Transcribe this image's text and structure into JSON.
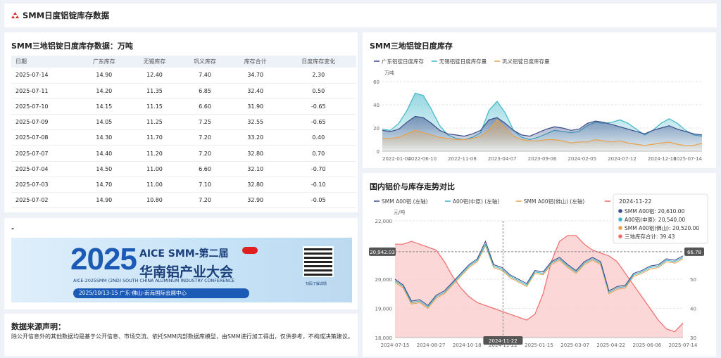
{
  "header": {
    "title": "SMM日度铝锭库存数据"
  },
  "table": {
    "title": "SMM三地铝锭日度库存数据：万吨",
    "columns": [
      "日期",
      "广东库存",
      "无锡库存",
      "巩义库存",
      "库存合计",
      "日度库存变化"
    ],
    "rows": [
      [
        "2025-07-14",
        "14.90",
        "12.40",
        "7.40",
        "34.70",
        "2.30"
      ],
      [
        "2025-07-11",
        "14.20",
        "11.35",
        "6.85",
        "32.40",
        "0.50"
      ],
      [
        "2025-07-10",
        "14.15",
        "11.15",
        "6.60",
        "31.90",
        "-0.65"
      ],
      [
        "2025-07-09",
        "14.05",
        "11.25",
        "7.25",
        "32.55",
        "-0.65"
      ],
      [
        "2025-07-08",
        "14.30",
        "11.70",
        "7.20",
        "33.20",
        "0.40"
      ],
      [
        "2025-07-07",
        "14.40",
        "11.20",
        "7.20",
        "32.80",
        "0.70"
      ],
      [
        "2025-07-04",
        "14.50",
        "11.00",
        "6.60",
        "32.10",
        "-0.70"
      ],
      [
        "2025-07-03",
        "14.70",
        "11.00",
        "7.10",
        "32.80",
        "-0.10"
      ],
      [
        "2025-07-02",
        "14.90",
        "10.80",
        "7.20",
        "32.90",
        "-0.05"
      ]
    ]
  },
  "ad": {
    "section": "-",
    "year": "2025",
    "line1": "AICE SMM-第二届",
    "line2": "华南铝产业大会",
    "line3": "AICE-2025SMM (2ND) SOUTH CHINA ALUMINUM INDUSTRY CONFERENCE",
    "line4": "2025/10/13-15  广东·佛山-南海国际会展中心",
    "qr_label": "扫码了解详情"
  },
  "source": {
    "title": "数据来源声明：",
    "body": "除公开信息外的其他数据均是基于公开信息、市场交流、依托SMM内部数据库模型，由SMM进行加工得出，仅供参考，不构成决策建议。"
  },
  "chart_data": [
    {
      "type": "area",
      "title": "SMM三地铝锭日度库存",
      "ylabel": "万吨",
      "ylim": [
        0,
        60
      ],
      "yticks": [
        "60",
        "40",
        "20",
        "0"
      ],
      "xticks": [
        "2022-01-04",
        "2022-06-10",
        "2022-11-08",
        "2023-04-07",
        "2023-09-06",
        "2024-02-05",
        "2024-07-12",
        "2024-12-16",
        "2025-07-14"
      ],
      "legend_position": "top-left",
      "series": [
        {
          "name": "广东铝锭日度库存",
          "color": "#3b4c8a",
          "values": [
            18,
            17,
            19,
            25,
            30,
            29,
            24,
            18,
            15,
            14,
            13,
            15,
            18,
            27,
            29,
            24,
            18,
            14,
            13,
            16,
            19,
            21,
            20,
            18,
            19,
            24,
            26,
            25,
            23,
            21,
            19,
            17,
            15,
            18,
            20,
            22,
            19,
            17,
            15,
            14
          ]
        },
        {
          "name": "无锡铝锭日度库存量",
          "color": "#3fb6c8",
          "values": [
            19,
            18,
            24,
            35,
            50,
            48,
            36,
            22,
            14,
            11,
            10,
            12,
            16,
            35,
            43,
            33,
            18,
            12,
            10,
            12,
            15,
            18,
            17,
            16,
            17,
            22,
            25,
            24,
            25,
            27,
            24,
            19,
            14,
            18,
            24,
            28,
            24,
            18,
            14,
            13
          ]
        },
        {
          "name": "巩义铝锭日度库存量",
          "color": "#e6a24e",
          "values": [
            11,
            11,
            12,
            15,
            18,
            16,
            14,
            12,
            11,
            10,
            10,
            11,
            13,
            18,
            27,
            20,
            13,
            10,
            9,
            9,
            10,
            10,
            9,
            7,
            8,
            8,
            10,
            9,
            8,
            9,
            7,
            6,
            5,
            6,
            7,
            8,
            6,
            5,
            5,
            7
          ]
        }
      ]
    },
    {
      "type": "line",
      "title": "国内铝价与库存走势对比",
      "ylabel": "元/吨",
      "ylim": [
        18000,
        22000
      ],
      "y2lim": [
        30,
        70
      ],
      "yticks": [
        "22,000",
        "20,000",
        "19,000",
        "18,000"
      ],
      "y2ticks": [
        "60",
        "50",
        "40",
        "30"
      ],
      "xticks": [
        "2024-07-15",
        "2024-08-27",
        "2024-10-18",
        "2024-11-22",
        "2025-01-15",
        "2025-03-07",
        "2025-04-22",
        "2025-06-06",
        "2025-07-14"
      ],
      "legend_position": "top-left",
      "cursor": {
        "date": "2024-11-22",
        "left_value": "20,942.03",
        "right_value": "66.78"
      },
      "tooltip": {
        "date": "2024-11-22",
        "rows": [
          "SMM A00铝: 20,610.00",
          "A00铝(中原): 20,540.00",
          "SMM A00铝(佛山): 20,520.00",
          "三地库存合计: 39.43"
        ]
      },
      "series": [
        {
          "name": "SMM A00铝 (左轴)",
          "color": "#3b4c8a",
          "values": [
            20000,
            19800,
            19250,
            19300,
            19100,
            19450,
            19600,
            19900,
            20200,
            20500,
            20700,
            21300,
            20500,
            20400,
            20150,
            20000,
            19850,
            20300,
            20250,
            20600,
            20750,
            20500,
            20300,
            20600,
            20750,
            20600,
            19600,
            19750,
            19800,
            20200,
            20300,
            20450,
            20500,
            20700,
            20650,
            20800
          ]
        },
        {
          "name": "A00铝(中原) (左轴)",
          "color": "#3fb6c8",
          "values": [
            19950,
            19750,
            19200,
            19250,
            19050,
            19400,
            19550,
            19850,
            20150,
            20450,
            20650,
            21200,
            20450,
            20350,
            20100,
            19950,
            19800,
            20250,
            20200,
            20550,
            20700,
            20450,
            20250,
            20550,
            20700,
            20550,
            19550,
            19700,
            19750,
            20150,
            20250,
            20400,
            20450,
            20650,
            20600,
            20750
          ]
        },
        {
          "name": "SMM A00铝(佛山) (左轴)",
          "color": "#e6a24e",
          "values": [
            19900,
            19700,
            19150,
            19200,
            19000,
            19350,
            19500,
            19800,
            20100,
            20400,
            20600,
            21150,
            20400,
            20300,
            20050,
            19900,
            19750,
            20200,
            20150,
            20500,
            20650,
            20400,
            20200,
            20500,
            20650,
            20500,
            19500,
            19650,
            19700,
            20100,
            20200,
            20350,
            20400,
            20600,
            20550,
            20700
          ]
        },
        {
          "name": "三地库存合计 (右轴)",
          "color": "#f06b6b",
          "values": [
            62,
            62,
            63,
            62,
            61,
            60,
            56,
            51,
            47,
            44,
            42,
            41,
            40,
            39,
            38,
            37,
            36,
            38,
            45,
            56,
            63,
            65,
            65,
            62,
            60,
            59,
            58,
            56,
            52,
            48,
            44,
            40,
            36,
            33,
            32,
            35
          ]
        }
      ]
    }
  ]
}
